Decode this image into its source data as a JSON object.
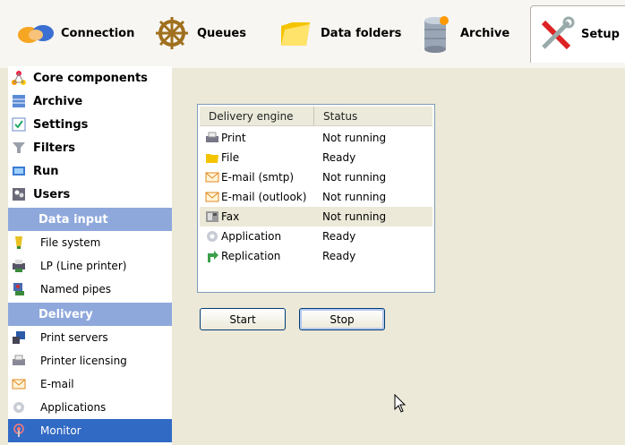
{
  "toolbar": {
    "connection": "Connection",
    "queues": "Queues",
    "data_folders": "Data folders",
    "archive": "Archive",
    "setup": "Setup"
  },
  "sidebar": {
    "core_components": "Core components",
    "archive": "Archive",
    "settings": "Settings",
    "filters": "Filters",
    "run": "Run",
    "users": "Users",
    "data_input_header": "Data input",
    "file_system": "File system",
    "lp_line_printer": "LP (Line printer)",
    "named_pipes": "Named pipes",
    "delivery_header": "Delivery",
    "print_servers": "Print servers",
    "printer_licensing": "Printer licensing",
    "email": "E-mail",
    "applications": "Applications",
    "monitor": "Monitor"
  },
  "engines": {
    "col_engine": "Delivery engine",
    "col_status": "Status",
    "rows": [
      {
        "name": "Print",
        "status": "Not running"
      },
      {
        "name": "File",
        "status": "Ready"
      },
      {
        "name": "E-mail (smtp)",
        "status": "Not running"
      },
      {
        "name": "E-mail (outlook)",
        "status": "Not running"
      },
      {
        "name": "Fax",
        "status": "Not running"
      },
      {
        "name": "Application",
        "status": "Ready"
      },
      {
        "name": "Replication",
        "status": "Ready"
      }
    ]
  },
  "buttons": {
    "start": "Start",
    "stop": "Stop"
  },
  "colors": {
    "accent": "#316ac5",
    "section_header": "#8fa8dc",
    "panel_bg": "#ece9d8"
  }
}
